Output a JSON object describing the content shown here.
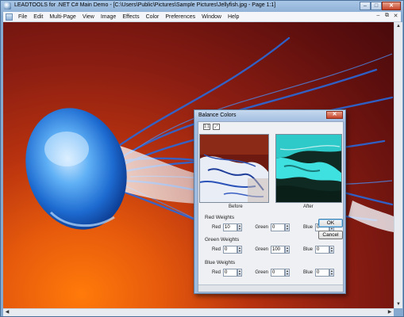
{
  "window": {
    "title": "LEADTOOLS for .NET C# Main Demo - [C:\\Users\\Public\\Pictures\\Sample Pictures\\Jellyfish.jpg - Page 1:1]",
    "minimize_glyph": "–",
    "maximize_glyph": "□",
    "close_glyph": "✕"
  },
  "menubar": {
    "items": [
      "File",
      "Edit",
      "Multi-Page",
      "View",
      "Image",
      "Effects",
      "Color",
      "Preferences",
      "Window",
      "Help"
    ],
    "mdi_minimize": "–",
    "mdi_restore": "⧉",
    "mdi_close": "✕"
  },
  "dialog": {
    "title": "Balance Colors",
    "close_glyph": "✕",
    "tool_one_to_one": "1:1",
    "tool_fit": "⤢",
    "before_label": "Before",
    "after_label": "After",
    "red_weights": {
      "section": "Red Weights",
      "red_label": "Red",
      "red_value": "10",
      "green_label": "Green",
      "green_value": "0",
      "blue_label": "Blue",
      "blue_value": "0"
    },
    "green_weights": {
      "section": "Green Weights",
      "red_label": "Red",
      "red_value": "0",
      "green_label": "Green",
      "green_value": "100",
      "blue_label": "Blue",
      "blue_value": "0"
    },
    "blue_weights": {
      "section": "Blue Weights",
      "red_label": "Red",
      "red_value": "0",
      "green_label": "Green",
      "green_value": "0",
      "blue_label": "Blue",
      "blue_value": "0"
    },
    "ok_label": "OK",
    "cancel_label": "Cancel"
  },
  "scroll": {
    "up": "▲",
    "down": "▼",
    "left": "◀",
    "right": "▶"
  },
  "colors": {
    "background_orange": "#e65a0c",
    "background_dark_red": "#4a0a0b",
    "jellyfish_blue": "#3a8fe0",
    "after_cyan": "#32e6e6"
  }
}
